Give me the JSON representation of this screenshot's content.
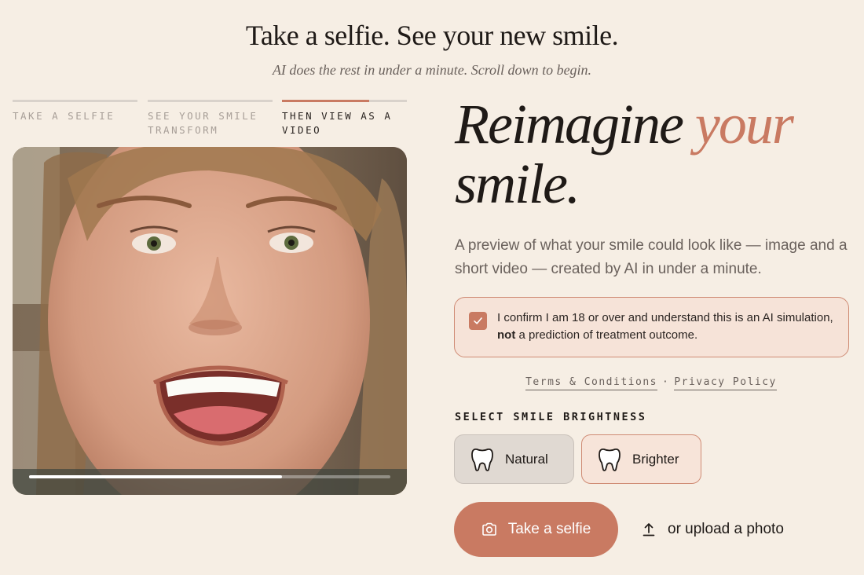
{
  "hero": {
    "title": "Take a selfie. See your new smile.",
    "subtitle": "AI does the rest in under a minute. Scroll down to begin."
  },
  "steps": [
    {
      "label": "TAKE A SELFIE",
      "progress": 0,
      "active": false
    },
    {
      "label": "SEE YOUR SMILE TRANSFORM",
      "progress": 0,
      "active": false
    },
    {
      "label": "THEN VIEW AS A VIDEO",
      "progress": 0.7,
      "active": true
    }
  ],
  "video": {
    "progress": 0.7
  },
  "headline": {
    "line1": "Reimagine ",
    "accent": "your",
    "line2": "smile."
  },
  "description": "A preview of what your smile could look like — image and a short video — created by AI in under a minute.",
  "consent": {
    "checked": true,
    "text_before": "I confirm I am 18 or over and understand this is an AI simulation, ",
    "bold": "not",
    "text_after": " a prediction of treatment outcome."
  },
  "legal": {
    "terms": "Terms & Conditions",
    "separator": "·",
    "privacy": "Privacy Policy"
  },
  "brightness": {
    "label": "SELECT SMILE BRIGHTNESS",
    "options": [
      {
        "label": "Natural",
        "icon": "tooth-icon"
      },
      {
        "label": "Brighter",
        "icon": "tooth-icon"
      }
    ]
  },
  "actions": {
    "selfie_label": "Take a selfie",
    "selfie_icon": "camera-icon",
    "upload_label": "or upload a photo",
    "upload_icon": "upload-icon"
  },
  "colors": {
    "background": "#f6eee4",
    "accent": "#c97a62",
    "text": "#1f1a17",
    "muted": "#6a615c"
  }
}
